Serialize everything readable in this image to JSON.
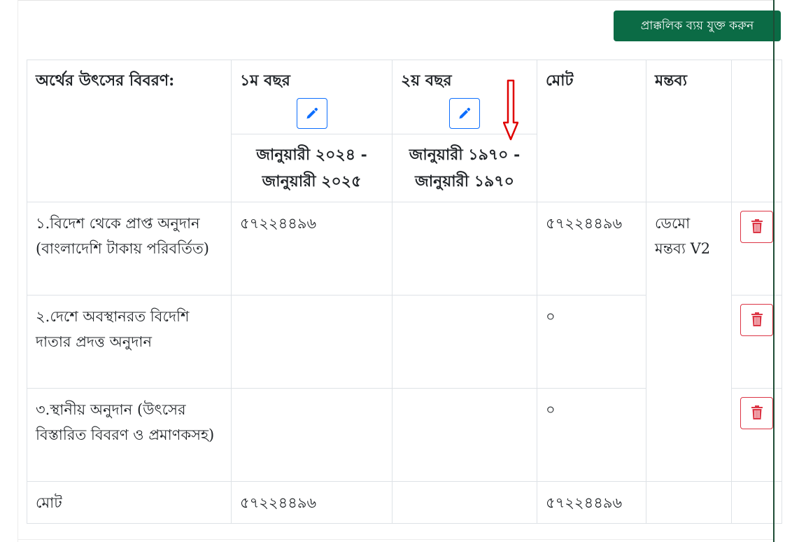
{
  "toolbar": {
    "add_expense_label": "প্রাক্কলিক ব্যয় যুক্ত করুন"
  },
  "table": {
    "headers": {
      "source": "অর্থের উৎসের বিবরণ:",
      "year1": "১ম বছর",
      "year2": "২য় বছর",
      "total": "মোট",
      "comment": "মন্তব্য"
    },
    "year1_range": "জানুয়ারী ২০২৪ - জানুয়ারী ২০২৫",
    "year2_range": "জানুয়ারী ১৯৭০ - জানুয়ারী ১৯৭০",
    "rows": [
      {
        "source": "১.বিদেশ থেকে প্রাপ্ত অনুদান (বাংলাদেশি টাকায় পরিবর্তিত)",
        "year1": "৫৭২২৪৪৯৬",
        "year2": "",
        "total": "৫৭২২৪৪৯৬"
      },
      {
        "source": "২.দেশে অবস্থানরত বিদেশি দাতার প্রদত্ত অনুদান",
        "year1": "",
        "year2": "",
        "total": "০"
      },
      {
        "source": "৩.স্থানীয় অনুদান (উৎসের বিস্তারিত বিবরণ ও প্রমাণকসহ)",
        "year1": "",
        "year2": "",
        "total": "০"
      }
    ],
    "comment_text": "ডেমো মন্তব্য V2",
    "footer": {
      "label": "মোট",
      "year1": "৫৭২২৪৪৯৬",
      "year2": "",
      "total": "৫৭২২৪৪৯৬"
    }
  },
  "icons": {
    "edit": "pencil-icon",
    "delete": "trash-icon",
    "annotation": "down-arrow-icon"
  },
  "colors": {
    "primary_button": "#0b6b45",
    "edit_outline": "#0d6efd",
    "delete_outline": "#dc3545",
    "annotation": "#e00000"
  }
}
